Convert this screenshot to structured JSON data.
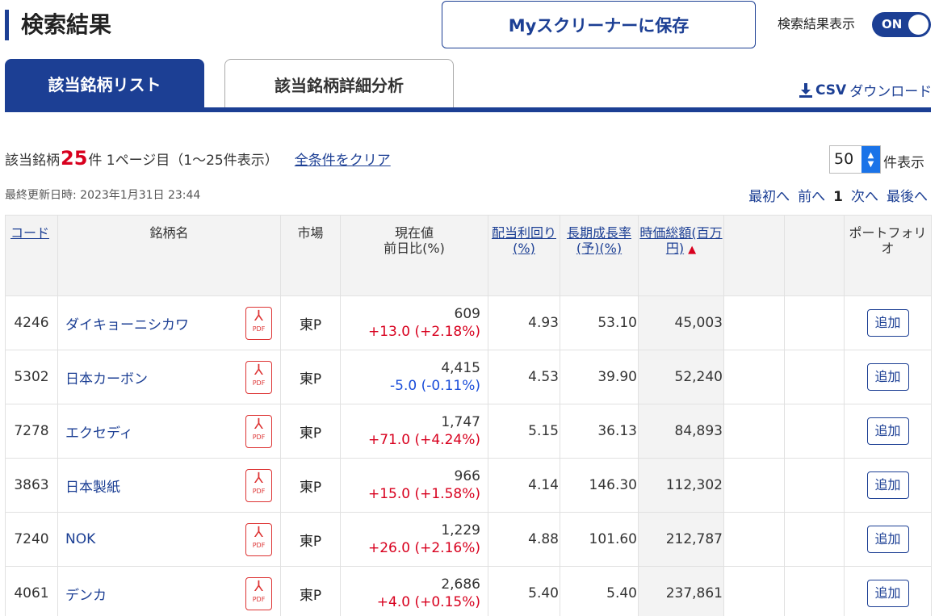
{
  "page_title": "検索結果",
  "save_button_label": "Myスクリーナーに保存",
  "toggle": {
    "label": "検索結果表示",
    "state": "ON"
  },
  "tabs": [
    {
      "label": "該当銘柄リスト",
      "active": true
    },
    {
      "label": "該当銘柄詳細分析",
      "active": false
    }
  ],
  "csv": {
    "bold": "CSV",
    "rest": "ダウンロード"
  },
  "summary": {
    "prefix": "該当銘柄",
    "count": "25",
    "suffix": "件 1ページ目（1〜25件表示）",
    "clear_label": "全条件をクリア"
  },
  "per_page": {
    "value": "50",
    "suffix": "件表示"
  },
  "updated": "最終更新日時: 2023年1月31日 23:44",
  "pager": {
    "first": "最初へ",
    "prev": "前へ",
    "current": "1",
    "next": "次へ",
    "last": "最後へ"
  },
  "table": {
    "headers": {
      "code": "コード",
      "name": "銘柄名",
      "market": "市場",
      "price_line1": "現在値",
      "price_line2": "前日比(%)",
      "dividend": "配当利回り(%)",
      "growth": "長期成長率(予)(%)",
      "market_cap": "時価総額(百万円)",
      "portfolio": "ポートフォリオ"
    },
    "pdf_label": "PDF",
    "add_label": "追加",
    "rows": [
      {
        "code": "4246",
        "name": "ダイキョーニシカワ",
        "market": "東P",
        "price": "609",
        "change": "+13.0 (+2.18%)",
        "dir": "up",
        "dividend": "4.93",
        "growth": "53.10",
        "cap": "45,003"
      },
      {
        "code": "5302",
        "name": "日本カーボン",
        "market": "東P",
        "price": "4,415",
        "change": "-5.0 (-0.11%)",
        "dir": "down",
        "dividend": "4.53",
        "growth": "39.90",
        "cap": "52,240"
      },
      {
        "code": "7278",
        "name": "エクセディ",
        "market": "東P",
        "price": "1,747",
        "change": "+71.0 (+4.24%)",
        "dir": "up",
        "dividend": "5.15",
        "growth": "36.13",
        "cap": "84,893"
      },
      {
        "code": "3863",
        "name": "日本製紙",
        "market": "東P",
        "price": "966",
        "change": "+15.0 (+1.58%)",
        "dir": "up",
        "dividend": "4.14",
        "growth": "146.30",
        "cap": "112,302"
      },
      {
        "code": "7240",
        "name": "NOK",
        "market": "東P",
        "price": "1,229",
        "change": "+26.0 (+2.16%)",
        "dir": "up",
        "dividend": "4.88",
        "growth": "101.60",
        "cap": "212,787"
      },
      {
        "code": "4061",
        "name": "デンカ",
        "market": "東P",
        "price": "2,686",
        "change": "+4.0 (+0.15%)",
        "dir": "up",
        "dividend": "5.40",
        "growth": "5.40",
        "cap": "237,861"
      }
    ]
  }
}
